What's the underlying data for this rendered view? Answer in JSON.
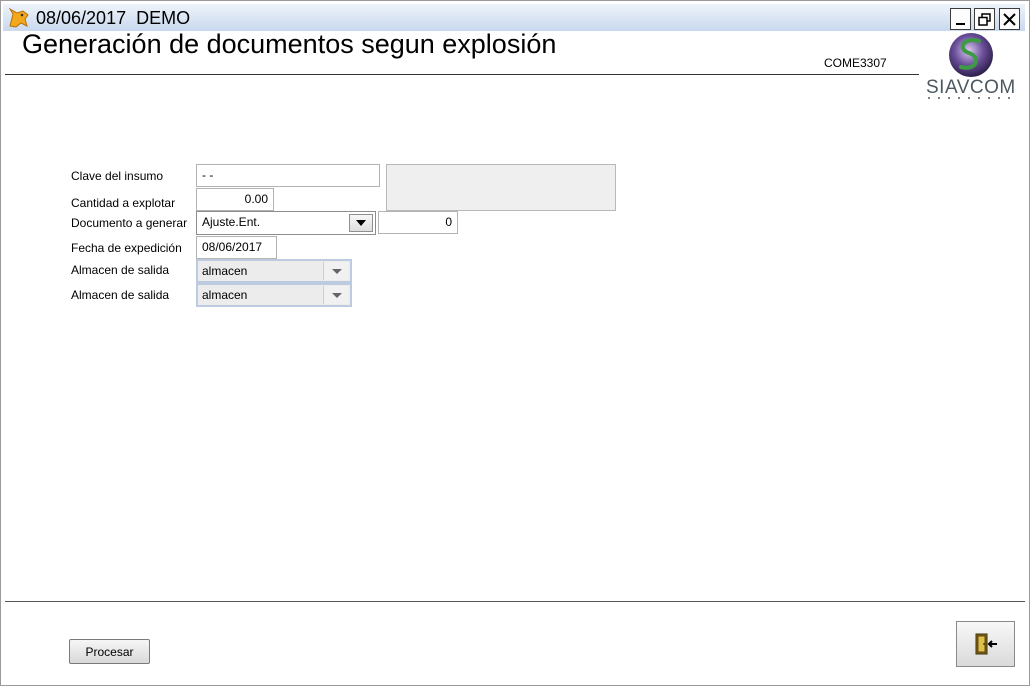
{
  "titlebar": {
    "title": "08/06/2017  DEMO",
    "minimize_icon": "minimize-icon",
    "restore_icon": "restore-icon",
    "close_icon": "close-icon"
  },
  "header": {
    "title": "Generación de documentos segun explosión",
    "screen_code": "COME3307",
    "logo_text": "SIAVCOM"
  },
  "form": {
    "clave_label": "Clave del insumo",
    "clave_value": "- -",
    "clave_description": "",
    "cantidad_label": "Cantidad a explotar",
    "cantidad_value": "0.00",
    "documento_label": "Documento a generar",
    "documento_value": "Ajuste.Ent.",
    "documento_number": "0",
    "fecha_label": "Fecha de expedición",
    "fecha_value": "08/06/2017",
    "almacen1_label": "Almacen de salida",
    "almacen1_value": "almacen",
    "almacen2_label": "Almacen de salida",
    "almacen2_value": "almacen"
  },
  "footer": {
    "procesar_label": "Procesar",
    "exit_icon": "exit-door-icon"
  },
  "colors": {
    "titlebar_top": "#eef3fa",
    "titlebar_bottom": "#c9d9ee",
    "logo_accent": "#2f7a3a",
    "logo_text": "#4c5960"
  }
}
